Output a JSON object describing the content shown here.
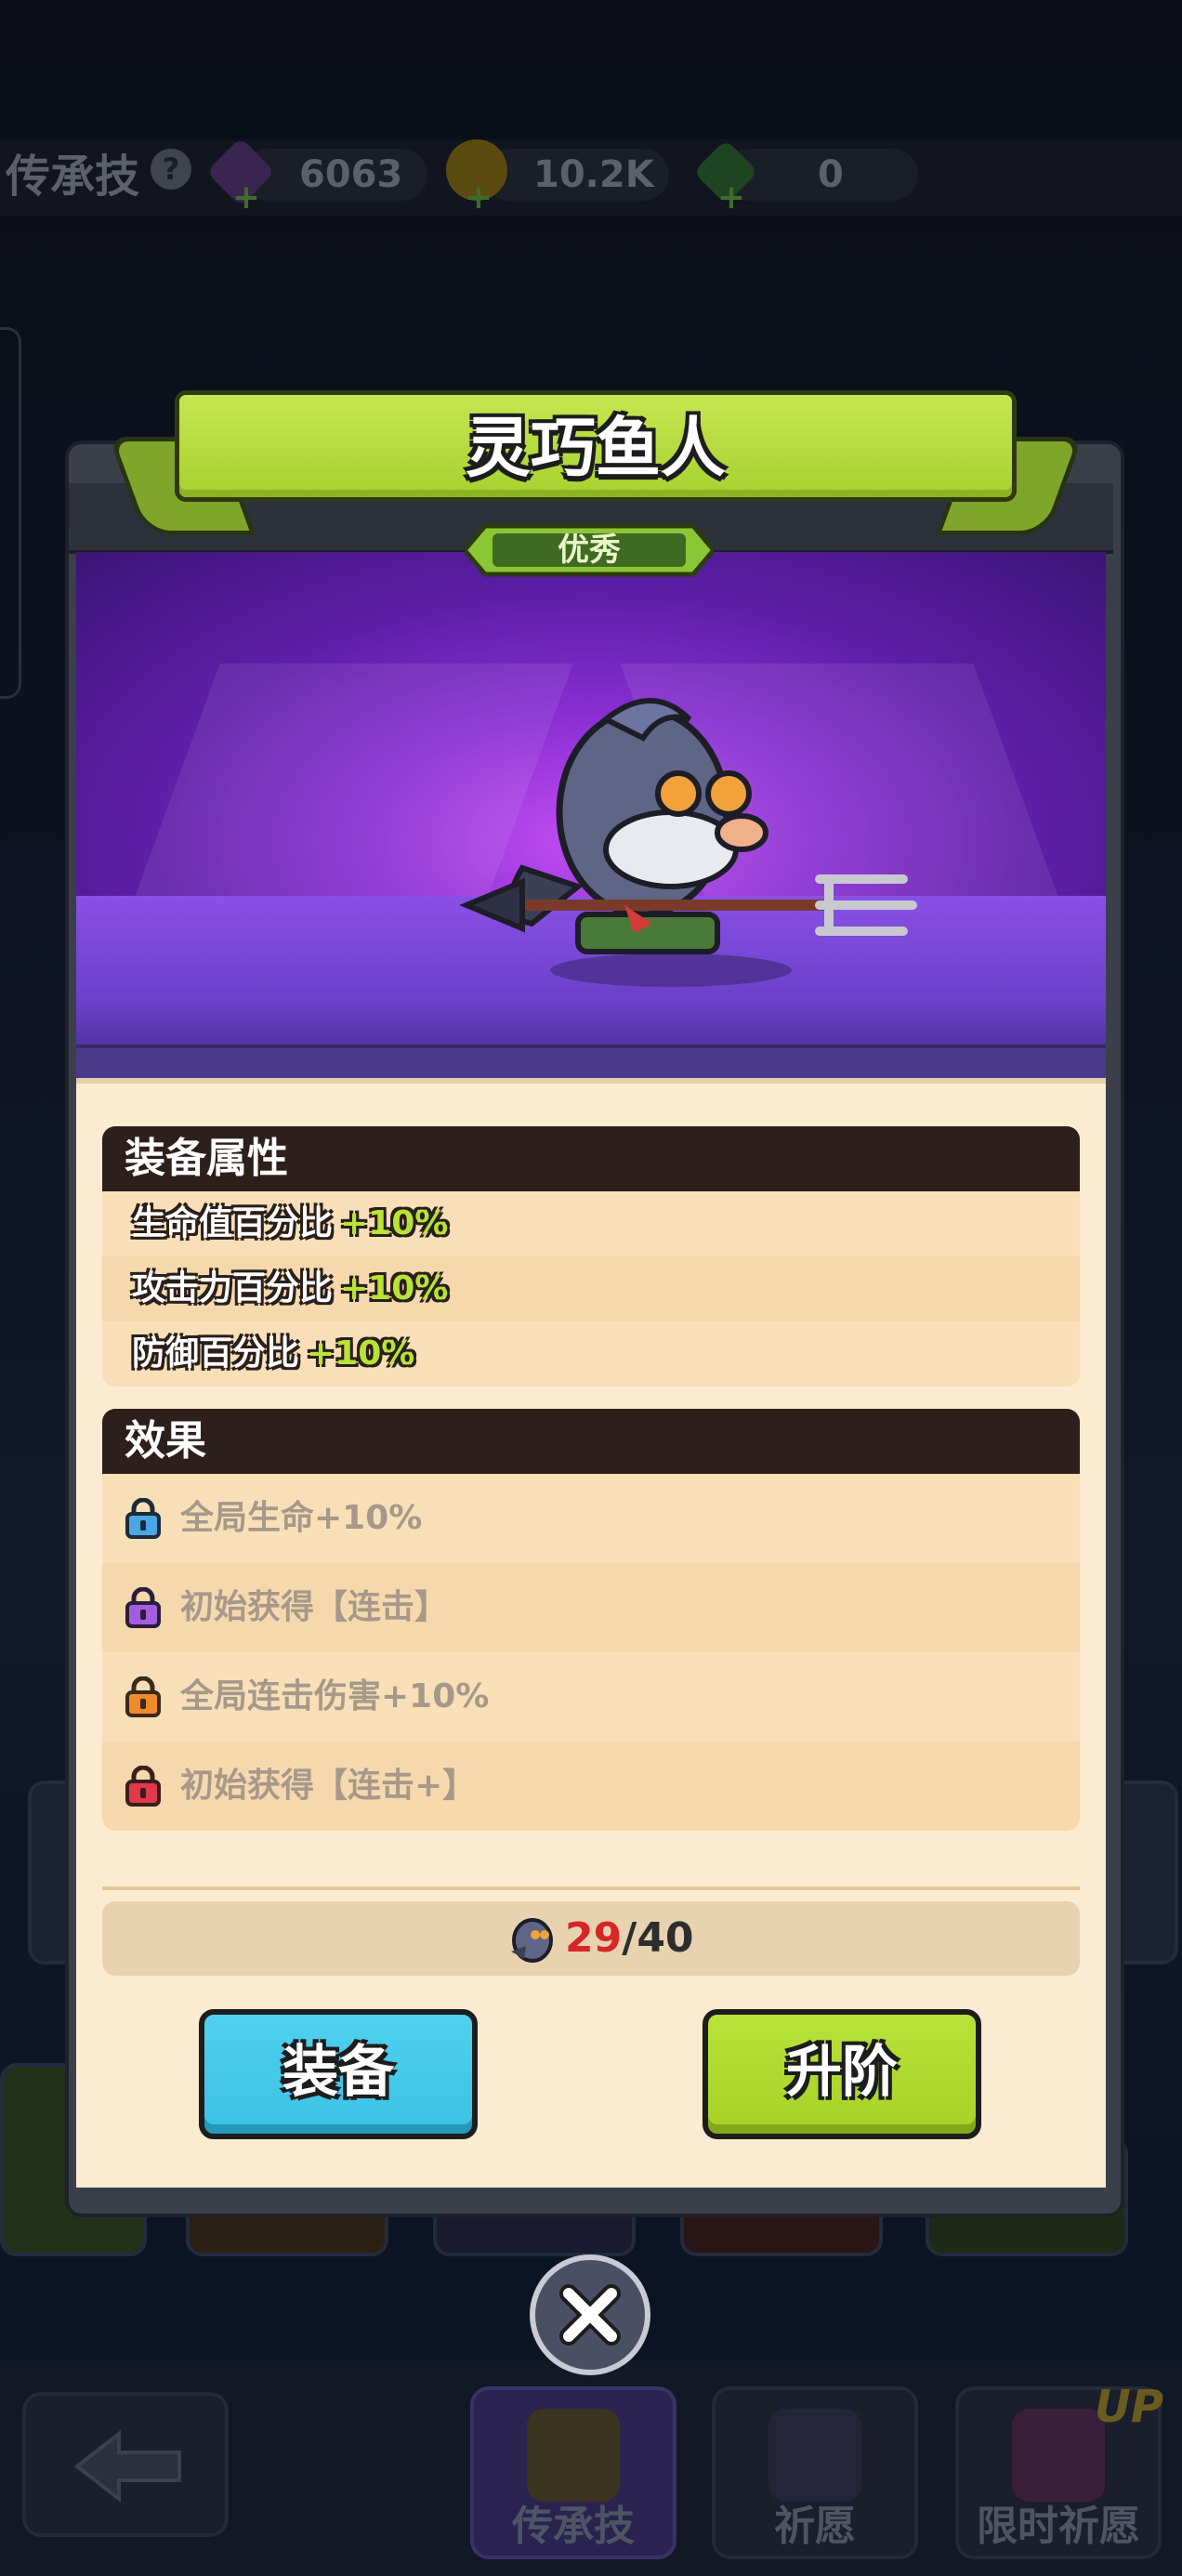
{
  "background": {
    "title": "传承技",
    "resources": [
      {
        "icon": "purple-gem-icon",
        "value": "6063"
      },
      {
        "icon": "gold-coin-icon",
        "value": "10.2K"
      },
      {
        "icon": "green-crystal-icon",
        "value": "0"
      }
    ],
    "nav": {
      "tabs": [
        {
          "label": "传承技"
        },
        {
          "label": "祈愿"
        },
        {
          "label": "限时祈愿",
          "badge": "UP"
        }
      ]
    }
  },
  "modal": {
    "title": "灵巧鱼人",
    "rarity": "优秀",
    "attributes": {
      "heading": "装备属性",
      "items": [
        {
          "label": "生命值百分比",
          "value": "+10%"
        },
        {
          "label": "攻击力百分比",
          "value": "+10%"
        },
        {
          "label": "防御百分比",
          "value": "+10%"
        }
      ]
    },
    "effects": {
      "heading": "效果",
      "items": [
        {
          "text": "全局生命+10%",
          "lock_color": "#4aa7e6"
        },
        {
          "text": "初始获得【连击】",
          "lock_color": "#a35ee0"
        },
        {
          "text": "全局连击伤害+10%",
          "lock_color": "#f08a2c"
        },
        {
          "text": "初始获得【连击+】",
          "lock_color": "#e0394a"
        }
      ]
    },
    "progress": {
      "current": "29",
      "sep": "/",
      "max": "40"
    },
    "buttons": {
      "equip": "装备",
      "upgrade": "升阶"
    }
  },
  "colors": {
    "ribbon": "#b5dc3a",
    "equip_button": "#45c8e8",
    "upgrade_button": "#ade02e",
    "stat_value": "#b8e337"
  }
}
